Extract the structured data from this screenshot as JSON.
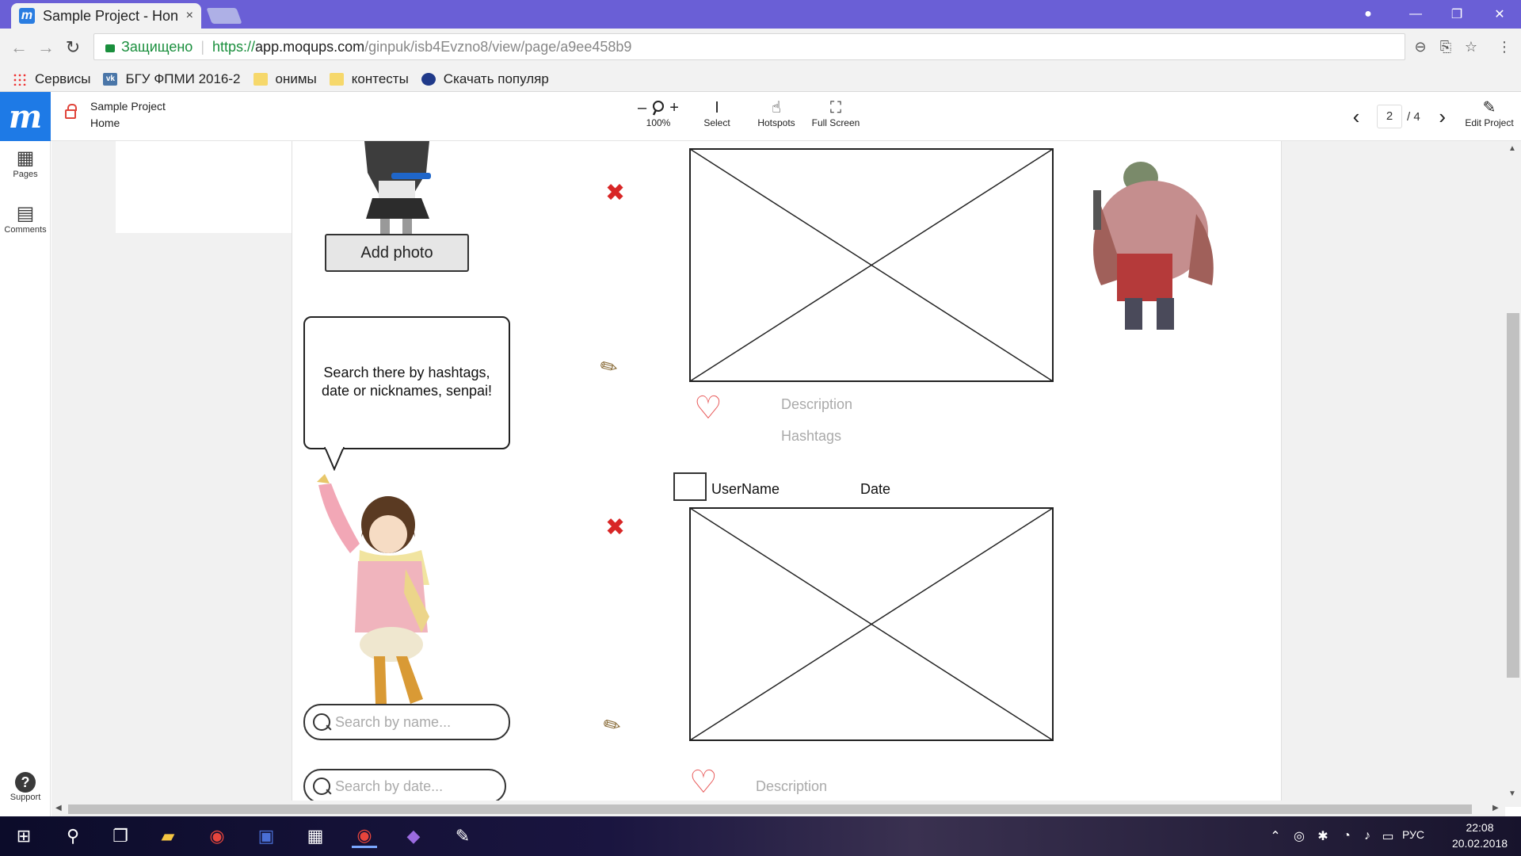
{
  "browser": {
    "tab_title": "Sample Project - Hon",
    "tab_close": "×",
    "window_controls": {
      "account": "●",
      "minimize": "—",
      "restore": "❐",
      "close": "✕"
    },
    "nav": {
      "back": "←",
      "forward": "→",
      "reload": "↻"
    },
    "address": {
      "security_label": "Защищено",
      "url_protocol": "https://",
      "url_host": "app.moqups.com",
      "url_path": "/ginpuk/isb4Evzno8/view/page/a9ee458b9"
    },
    "omni_icons": {
      "zoom": "⊖",
      "translate": "⎘",
      "star": "☆",
      "menu": "⋮"
    },
    "bookmarks": [
      {
        "label": "Сервисы",
        "icon": "apps-icon"
      },
      {
        "label": "БГУ ФПМИ 2016-2",
        "icon": "vk-icon"
      },
      {
        "label": "онимы",
        "icon": "folder-icon"
      },
      {
        "label": "контесты",
        "icon": "folder-icon"
      },
      {
        "label": "Скачать популяр",
        "icon": "globe-icon"
      }
    ]
  },
  "moqups": {
    "logo": "m",
    "project_name": "Sample Project",
    "page_name": "Home",
    "tools": {
      "zoom_minus": "–",
      "zoom_plus": "+",
      "zoom_label": "100%",
      "select_label": "Select",
      "hotspots_label": "Hotspots",
      "fullscreen_label": "Full Screen",
      "edit_label": "Edit Project"
    },
    "pager": {
      "prev": "‹",
      "next": "›",
      "current": "2",
      "total": "/ 4"
    },
    "left_rail": {
      "pages": "Pages",
      "comments": "Comments",
      "support": "Support",
      "support_glyph": "?"
    }
  },
  "mockup": {
    "add_photo_button": "Add photo",
    "speech_bubble": "Search there by hashtags, date or nicknames, senpai!",
    "search_by_name_placeholder": "Search by name...",
    "search_by_date_placeholder": "Search  by date...",
    "post1": {
      "description": "Description",
      "hashtags": "Hashtags"
    },
    "post2": {
      "username": "UserName",
      "date": "Date",
      "description": "Description"
    },
    "delete_glyph": "✖",
    "edit_glyph": "✎",
    "like_glyph": "♡"
  },
  "taskbar": {
    "lang": "РУС",
    "time": "22:08",
    "date": "20.02.2018"
  },
  "colors": {
    "titlebar": "#6a5fd6",
    "moqups_blue": "#1e7ae6",
    "secure_green": "#1a8f3d",
    "delete_red": "#d82626"
  }
}
